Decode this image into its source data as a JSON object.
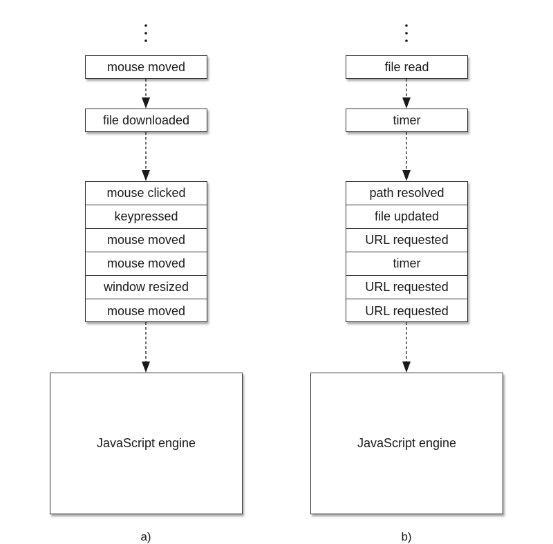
{
  "panels": [
    {
      "caption": "a)",
      "recent_events": [
        "mouse moved",
        "file downloaded"
      ],
      "queue": [
        "mouse clicked",
        "keypressed",
        "mouse moved",
        "mouse moved",
        "window resized",
        "mouse moved"
      ],
      "engine_label": "JavaScript engine"
    },
    {
      "caption": "b)",
      "recent_events": [
        "file read",
        "timer"
      ],
      "queue": [
        "path resolved",
        "file updated",
        "URL requested",
        "timer",
        "URL requested",
        "URL requested"
      ],
      "engine_label": "JavaScript engine"
    }
  ],
  "colors": {
    "line": "#333333",
    "arrow": "#1a1a1a"
  }
}
